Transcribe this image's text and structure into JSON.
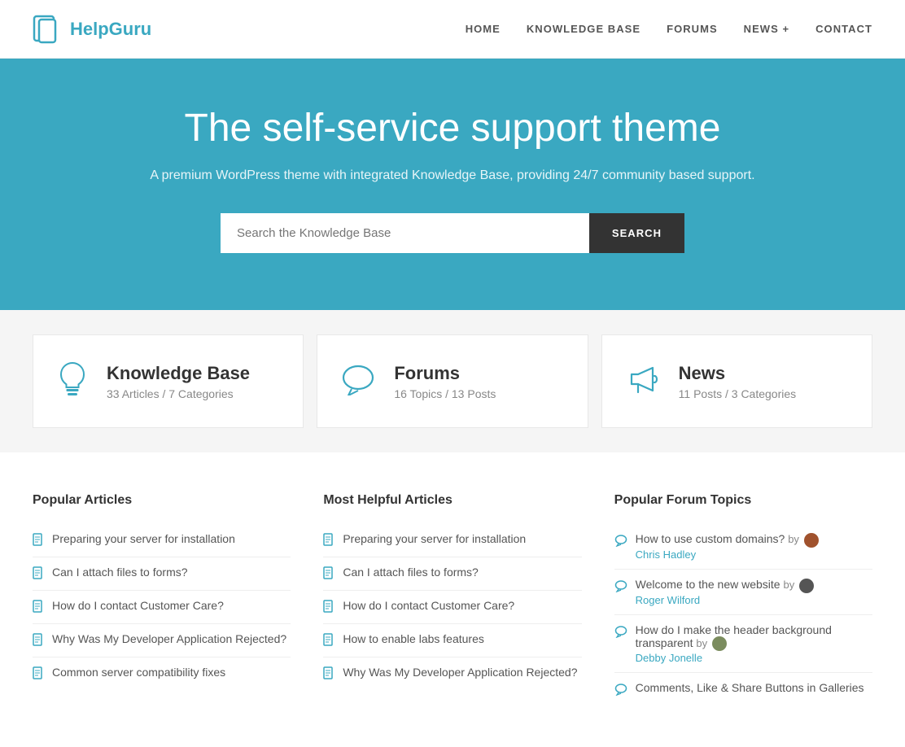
{
  "header": {
    "logo_text": "HelpGuru",
    "nav": [
      {
        "label": "HOME",
        "href": "#"
      },
      {
        "label": "KNOWLEDGE BASE",
        "href": "#"
      },
      {
        "label": "FORUMS",
        "href": "#"
      },
      {
        "label": "NEWS +",
        "href": "#"
      },
      {
        "label": "CONTACT",
        "href": "#"
      }
    ]
  },
  "hero": {
    "heading": "The self-service support theme",
    "subheading": "A premium WordPress theme with integrated Knowledge Base, providing 24/7 community based support.",
    "search_placeholder": "Search the Knowledge Base",
    "search_button": "SEARCH"
  },
  "stats": [
    {
      "name": "Knowledge Base",
      "detail": "33 Articles / 7 Categories",
      "icon": "lightbulb"
    },
    {
      "name": "Forums",
      "detail": "16 Topics / 13 Posts",
      "icon": "chat"
    },
    {
      "name": "News",
      "detail": "11 Posts / 3 Categories",
      "icon": "megaphone"
    }
  ],
  "popular_articles": {
    "heading": "Popular Articles",
    "items": [
      "Preparing your server for installation",
      "Can I attach files to forms?",
      "How do I contact Customer Care?",
      "Why Was My Developer Application Rejected?",
      "Common server compatibility fixes"
    ]
  },
  "helpful_articles": {
    "heading": "Most Helpful Articles",
    "items": [
      "Preparing your server for installation",
      "Can I attach files to forms?",
      "How do I contact Customer Care?",
      "How to enable labs features",
      "Why Was My Developer Application Rejected?"
    ]
  },
  "forum_topics": {
    "heading": "Popular Forum Topics",
    "items": [
      {
        "text": "How to use custom domains?",
        "by": "by",
        "author": "Chris Hadley",
        "avatar_class": "avatar-brown"
      },
      {
        "text": "Welcome to the new website",
        "by": "by",
        "author": "Roger Wilford",
        "avatar_class": "avatar-dark"
      },
      {
        "text": "How do I make the header background transparent",
        "by": "by",
        "author": "Debby Jonelle",
        "avatar_class": "avatar-olive"
      },
      {
        "text": "Comments, Like & Share Buttons in Galleries",
        "by": "",
        "author": "",
        "avatar_class": ""
      }
    ]
  }
}
